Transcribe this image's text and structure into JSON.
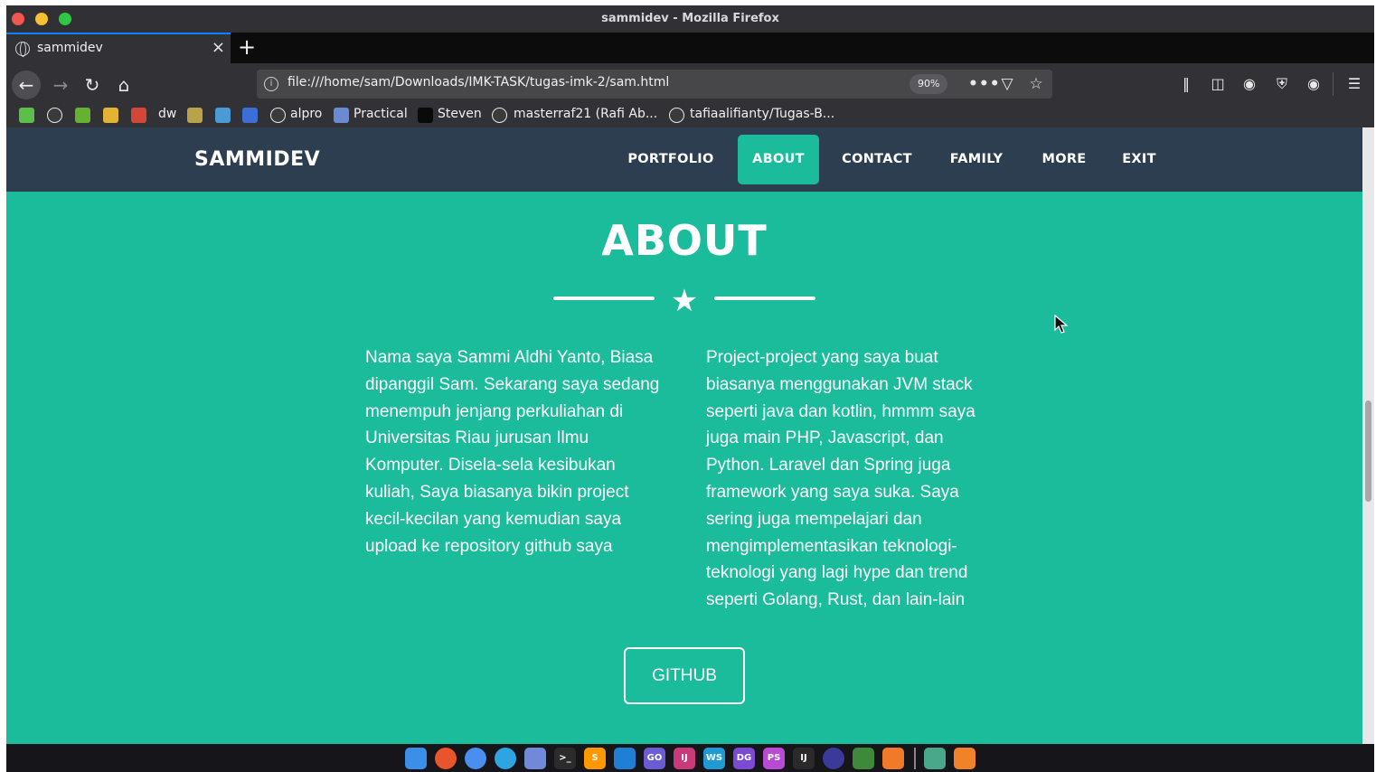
{
  "window": {
    "title": "sammidev - Mozilla Firefox"
  },
  "tab": {
    "title": "sammidev",
    "close_glyph": "×",
    "new_tab_glyph": "+"
  },
  "toolbar": {
    "url": "file:///home/sam/Downloads/IMK-TASK/tugas-imk-2/sam.html",
    "zoom": "90%",
    "more_glyph": "•••"
  },
  "bookmarks": [
    {
      "label": "",
      "icon": "leaf-icon",
      "color": "#5bbf4a"
    },
    {
      "label": "",
      "icon": "github-icon",
      "color": "#3a3a3a"
    },
    {
      "label": "",
      "icon": "android-icon",
      "color": "#66b032"
    },
    {
      "label": "",
      "icon": "picture-icon",
      "color": "#e2b335"
    },
    {
      "label": "",
      "icon": "gmail-icon",
      "color": "#d44638"
    },
    {
      "label": "dw",
      "icon": "dw-icon",
      "color": "#323236"
    },
    {
      "label": "",
      "icon": "question-icon",
      "color": "#b8a34a"
    },
    {
      "label": "",
      "icon": "hexagon-icon",
      "color": "#4a9ad4"
    },
    {
      "label": "",
      "icon": "infinity-icon",
      "color": "#3b6fd4"
    },
    {
      "label": "alpro",
      "icon": "github-icon",
      "color": "#3a3a3a"
    },
    {
      "label": "Practical",
      "icon": "feather-icon",
      "color": "#6a8ad4"
    },
    {
      "label": "Steven",
      "icon": "dev-icon",
      "color": "#0a0a0a"
    },
    {
      "label": "masterraf21 (Rafi Ab...",
      "icon": "github-icon",
      "color": "#3a3a3a"
    },
    {
      "label": "tafiaalifianty/Tugas-B...",
      "icon": "github-icon",
      "color": "#3a3a3a"
    }
  ],
  "page": {
    "brand": "SAMMIDEV",
    "nav": [
      {
        "label": "PORTFOLIO",
        "active": false
      },
      {
        "label": "ABOUT",
        "active": true
      },
      {
        "label": "CONTACT",
        "active": false
      },
      {
        "label": "FAMILY",
        "active": false
      },
      {
        "label": "MORE",
        "active": false
      },
      {
        "label": "EXIT",
        "active": false
      }
    ],
    "section_title": "ABOUT",
    "left_lines": [
      "Nama saya Sammi Aldhi Yanto, Biasa",
      "dipanggil Sam. Sekarang saya sedang",
      "menempuh jenjang perkuliahan di",
      "Universitas Riau jurusan Ilmu",
      "Komputer. Disela-sela kesibukan",
      "kuliah, Saya biasanya bikin project",
      "kecil-kecilan yang kemudian saya",
      "upload ke repository github saya"
    ],
    "right_lines": [
      "Project-project yang saya buat",
      "biasanya menggunakan JVM stack",
      "seperti java dan kotlin, hmmm saya",
      "juga main PHP, Javascript, dan",
      "Python. Laravel dan Spring juga",
      "framework yang saya suka. Saya",
      "sering juga mempelajari dan",
      "mengimplementasikan teknologi-",
      "teknologi yang lagi hype dan trend",
      "seperti Golang, Rust, dan lain-lain"
    ],
    "button_label": "GITHUB"
  },
  "colors": {
    "navbar": "#2c3e50",
    "accent": "#1abc9c"
  },
  "dock": [
    {
      "icon": "finder-icon",
      "color": "#3b8fe8",
      "text": ""
    },
    {
      "icon": "firefox-icon",
      "color": "#e8542b",
      "text": ""
    },
    {
      "icon": "chromium-icon",
      "color": "#4a8ef0",
      "text": ""
    },
    {
      "icon": "telegram-icon",
      "color": "#2ca5e0",
      "text": ""
    },
    {
      "icon": "discord-icon",
      "color": "#7289da",
      "text": ""
    },
    {
      "icon": "terminal-icon",
      "color": "#2b2b2b",
      "text": ">_"
    },
    {
      "icon": "sublime-icon",
      "color": "#ff9800",
      "text": "S"
    },
    {
      "icon": "vscode-icon",
      "color": "#1f7fd4",
      "text": ""
    },
    {
      "icon": "goland-icon",
      "color": "#6a5cd4",
      "text": "GO"
    },
    {
      "icon": "intellij-icon",
      "color": "#c93a7a",
      "text": "IJ"
    },
    {
      "icon": "webstorm-icon",
      "color": "#1f9ad4",
      "text": "WS"
    },
    {
      "icon": "datagrip-icon",
      "color": "#7a4ad4",
      "text": "DG"
    },
    {
      "icon": "phpstorm-icon",
      "color": "#b84ad4",
      "text": "PS"
    },
    {
      "icon": "intellij-ce-icon",
      "color": "#2a2a2a",
      "text": "IJ"
    },
    {
      "icon": "eclipse-icon",
      "color": "#3a3a9a",
      "text": ""
    },
    {
      "icon": "mongodb-icon",
      "color": "#3f8a3a",
      "text": ""
    },
    {
      "icon": "postman-icon",
      "color": "#f07a2a",
      "text": ""
    },
    {
      "icon": "files-icon",
      "color": "#4aa88a",
      "text": ""
    },
    {
      "icon": "package-icon",
      "color": "#f0822a",
      "text": ""
    }
  ]
}
